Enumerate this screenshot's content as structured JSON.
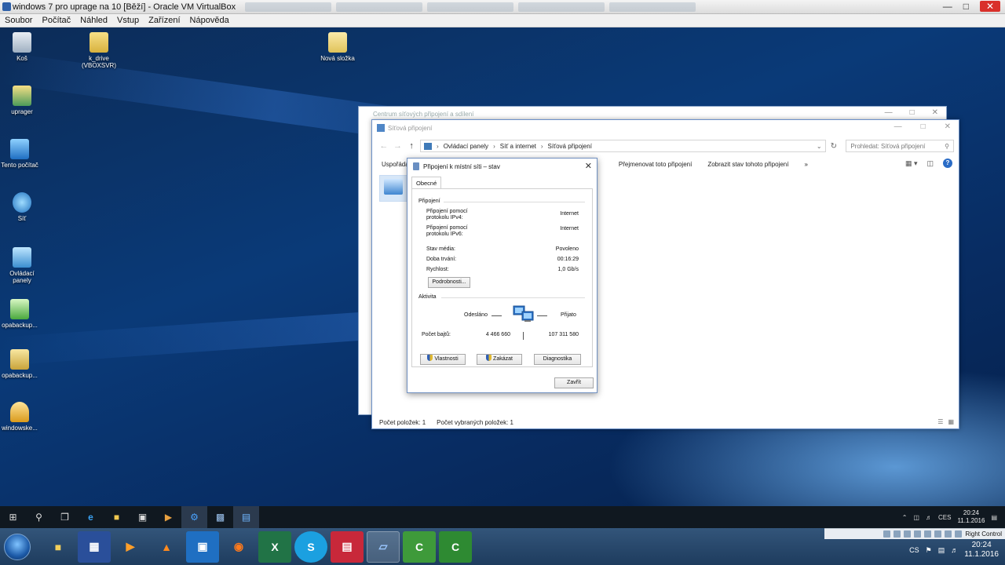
{
  "host": {
    "title": "windows 7 pro uprage na 10 [Běží] - Oracle VM VirtualBox",
    "menu": [
      "Soubor",
      "Počítač",
      "Náhled",
      "Vstup",
      "Zařízení",
      "Nápověda"
    ],
    "host_key_label": "Right Control",
    "language": "CS",
    "clock_time": "20:24",
    "clock_date": "11.1.2016"
  },
  "desktop": {
    "icons": [
      {
        "label": "Koš"
      },
      {
        "label": "k_drive (VBOXSVR)"
      },
      {
        "label": "Nová složka"
      },
      {
        "label": "uprager"
      },
      {
        "label": "Tento počítač"
      },
      {
        "label": "Síť"
      },
      {
        "label": "Ovládací panely"
      },
      {
        "label": "opabackup..."
      },
      {
        "label": "opabackup..."
      },
      {
        "label": "windowske..."
      }
    ]
  },
  "back_window": {
    "title": "Centrum síťových připojení a sdílení"
  },
  "explorer": {
    "title": "Síťová připojení",
    "breadcrumb": [
      "Ovládací panely",
      "Síť a internet",
      "Síťová připojení"
    ],
    "search_placeholder": "Prohledat: Síťová připojení",
    "toolbar": {
      "organize": "Uspořádat",
      "rename": "Přejmenovat toto připojení",
      "show_status": "Zobrazit stav tohoto připojení",
      "more": "»"
    },
    "status": {
      "items": "Počet položek: 1",
      "selected": "Počet vybraných položek: 1"
    }
  },
  "dialog": {
    "title": "Připojení k místní síti – stav",
    "tab": "Obecné",
    "connection_group": "Připojení",
    "rows": [
      {
        "label": "Připojení pomocí protokolu IPv4:",
        "value": "Internet"
      },
      {
        "label": "Připojení pomocí protokolu IPv6:",
        "value": "Internet"
      },
      {
        "label": "Stav média:",
        "value": "Povoleno"
      },
      {
        "label": "Doba trvání:",
        "value": "00:16:29"
      },
      {
        "label": "Rychlost:",
        "value": "1,0 Gb/s"
      }
    ],
    "details_button": "Podrobnosti...",
    "activity_group": "Aktivita",
    "sent_label": "Odesláno",
    "received_label": "Přijato",
    "bytes_label": "Počet bajtů:",
    "bytes_sent": "4 466 660",
    "bytes_received": "107 311 580",
    "properties_button": "Vlastnosti",
    "disable_button": "Zakázat",
    "diagnose_button": "Diagnostika",
    "close_button": "Zavřít"
  },
  "guest_taskbar": {
    "language": "CES",
    "clock_time": "20:24",
    "clock_date": "11.1.2016"
  }
}
